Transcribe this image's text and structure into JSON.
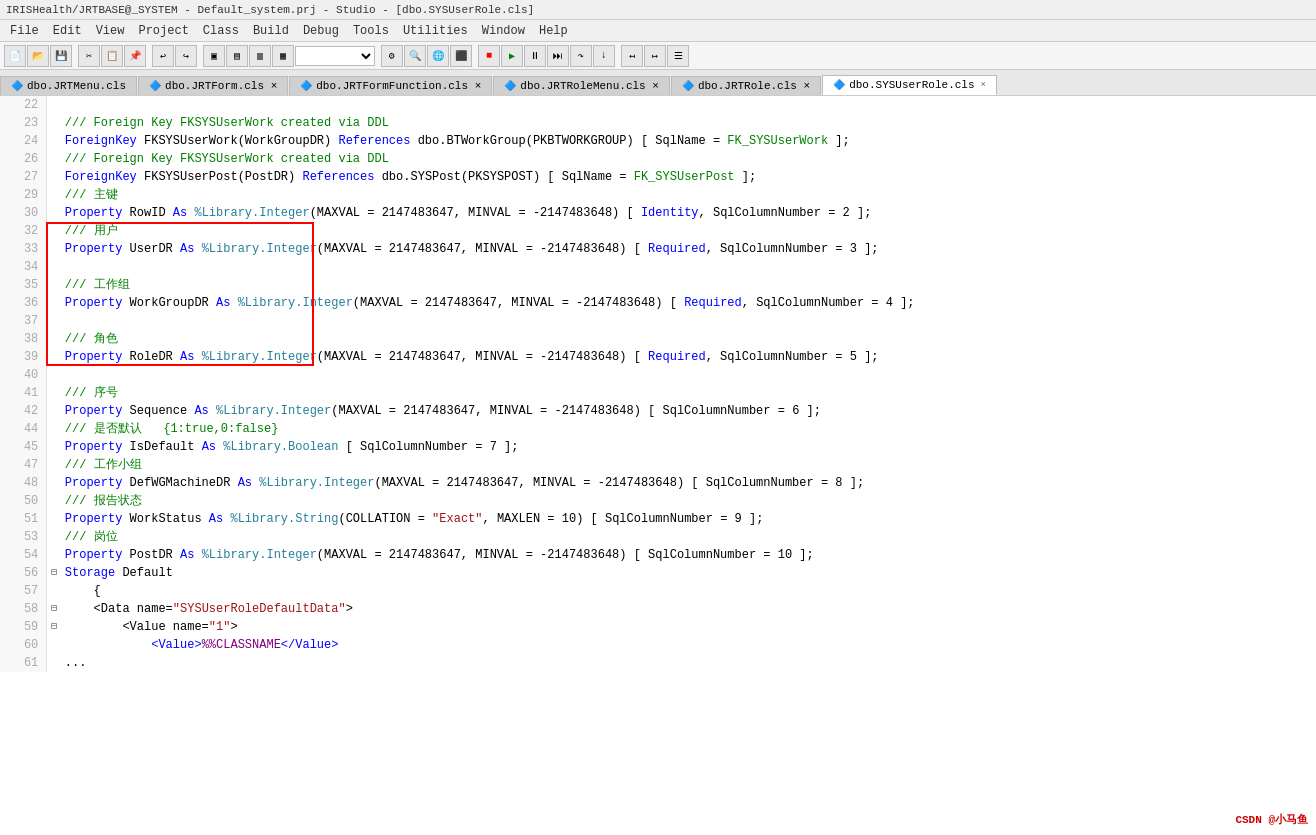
{
  "titlebar": {
    "text": "IRISHealth/JRTBASE@_SYSTEM - Default_system.prj - Studio - [dbo.SYSUserRole.cls]"
  },
  "menubar": {
    "items": [
      "File",
      "Edit",
      "View",
      "Project",
      "Class",
      "Build",
      "Debug",
      "Tools",
      "Utilities",
      "Window",
      "Help"
    ]
  },
  "tabbar": {
    "tabs": [
      {
        "label": "dbo.JRTMenu.cls",
        "icon": "🔷",
        "active": false
      },
      {
        "label": "dbo.JRTForm.cls",
        "icon": "🔷",
        "active": false,
        "modified": true
      },
      {
        "label": "dbo.JRTFormFunction.cls",
        "icon": "🔷",
        "active": false,
        "modified": true
      },
      {
        "label": "dbo.JRTRoleMenu.cls",
        "icon": "🔷",
        "active": false,
        "modified": true
      },
      {
        "label": "dbo.JRTRole.cls",
        "icon": "🔷",
        "active": false,
        "modified": true
      },
      {
        "label": "dbo.SYSUserRole.cls",
        "icon": "🔷",
        "active": true,
        "modified": false
      }
    ]
  },
  "code": {
    "lines": [
      {
        "num": "22",
        "fold": "",
        "content": ""
      },
      {
        "num": "23",
        "fold": "",
        "content": "/// Foreign Key FKSYSUserWork created via DDL"
      },
      {
        "num": "24",
        "fold": "",
        "content": "ForeignKey FKSYSUserWork(WorkGroupDR) References dbo.BTWorkGroup(PKBTWORKGROUP) [ SqlName = FK_SYSUserWork ];"
      },
      {
        "num": "",
        "fold": "",
        "content": ""
      },
      {
        "num": "26",
        "fold": "",
        "content": "/// Foreign Key FKSYSUserWork created via DDL"
      },
      {
        "num": "27",
        "fold": "",
        "content": "ForeignKey FKSYSUserPost(PostDR) References dbo.SYSPost(PKSYSPOST) [ SqlName = FK_SYSUserPost ];"
      },
      {
        "num": "",
        "fold": "",
        "content": ""
      },
      {
        "num": "29",
        "fold": "",
        "content": "/// 主键"
      },
      {
        "num": "30",
        "fold": "",
        "content": "Property RowID As %Library.Integer(MAXVAL = 2147483647, MINVAL = -2147483648) [ Identity, SqlColumnNumber = 2 ];"
      },
      {
        "num": "",
        "fold": "",
        "content": ""
      },
      {
        "num": "32",
        "fold": "",
        "content": "/// 用户",
        "highlight": true
      },
      {
        "num": "33",
        "fold": "",
        "content": "Property UserDR As %Library.Integer(MAXVAL = 2147483647, MINVAL = -2147483648) [ Required, SqlColumnNumber = 3 ];",
        "highlight": true
      },
      {
        "num": "34",
        "fold": "",
        "content": "",
        "highlight": true
      },
      {
        "num": "35",
        "fold": "",
        "content": "/// 工作组",
        "highlight": true
      },
      {
        "num": "36",
        "fold": "",
        "content": "Property WorkGroupDR As %Library.Integer(MAXVAL = 2147483647, MINVAL = -2147483648) [ Required, SqlColumnNumber = 4 ];",
        "highlight": true
      },
      {
        "num": "37",
        "fold": "",
        "content": "",
        "highlight": true
      },
      {
        "num": "38",
        "fold": "",
        "content": "/// 角色",
        "highlight": true
      },
      {
        "num": "39",
        "fold": "",
        "content": "Property RoleDR As %Library.Integer(MAXVAL = 2147483647, MINVAL = -2147483648) [ Required, SqlColumnNumber = 5 ];",
        "highlight": true
      },
      {
        "num": "40",
        "fold": "",
        "content": ""
      },
      {
        "num": "41",
        "fold": "",
        "content": "/// 序号"
      },
      {
        "num": "42",
        "fold": "",
        "content": "Property Sequence As %Library.Integer(MAXVAL = 2147483647, MINVAL = -2147483648) [ SqlColumnNumber = 6 ];"
      },
      {
        "num": "",
        "fold": "",
        "content": ""
      },
      {
        "num": "44",
        "fold": "",
        "content": "/// 是否默认   {1:true,0:false}"
      },
      {
        "num": "45",
        "fold": "",
        "content": "Property IsDefault As %Library.Boolean [ SqlColumnNumber = 7 ];"
      },
      {
        "num": "",
        "fold": "",
        "content": ""
      },
      {
        "num": "47",
        "fold": "",
        "content": "/// 工作小组"
      },
      {
        "num": "48",
        "fold": "",
        "content": "Property DefWGMachineDR As %Library.Integer(MAXVAL = 2147483647, MINVAL = -2147483648) [ SqlColumnNumber = 8 ];"
      },
      {
        "num": "",
        "fold": "",
        "content": ""
      },
      {
        "num": "50",
        "fold": "",
        "content": "/// 报告状态"
      },
      {
        "num": "51",
        "fold": "",
        "content": "Property WorkStatus As %Library.String(COLLATION = \"Exact\", MAXLEN = 10) [ SqlColumnNumber = 9 ];"
      },
      {
        "num": "",
        "fold": "",
        "content": ""
      },
      {
        "num": "53",
        "fold": "",
        "content": "/// 岗位"
      },
      {
        "num": "54",
        "fold": "",
        "content": "Property PostDR As %Library.Integer(MAXVAL = 2147483647, MINVAL = -2147483648) [ SqlColumnNumber = 10 ];"
      },
      {
        "num": "",
        "fold": "",
        "content": ""
      },
      {
        "num": "56",
        "fold": "⊟",
        "content": "Storage Default"
      },
      {
        "num": "57",
        "fold": "",
        "content": "    {"
      },
      {
        "num": "58",
        "fold": "⊟",
        "content": "    <Data name=\"SYSUserRoleDefaultData\">"
      },
      {
        "num": "59",
        "fold": "⊟",
        "content": "        <Value name=\"1\">"
      },
      {
        "num": "60",
        "fold": "",
        "content": "            <Value>%%CLASSNAME</Value>"
      },
      {
        "num": "61",
        "fold": "",
        "content": "..."
      }
    ]
  },
  "watermark": "CSDN @小马鱼"
}
